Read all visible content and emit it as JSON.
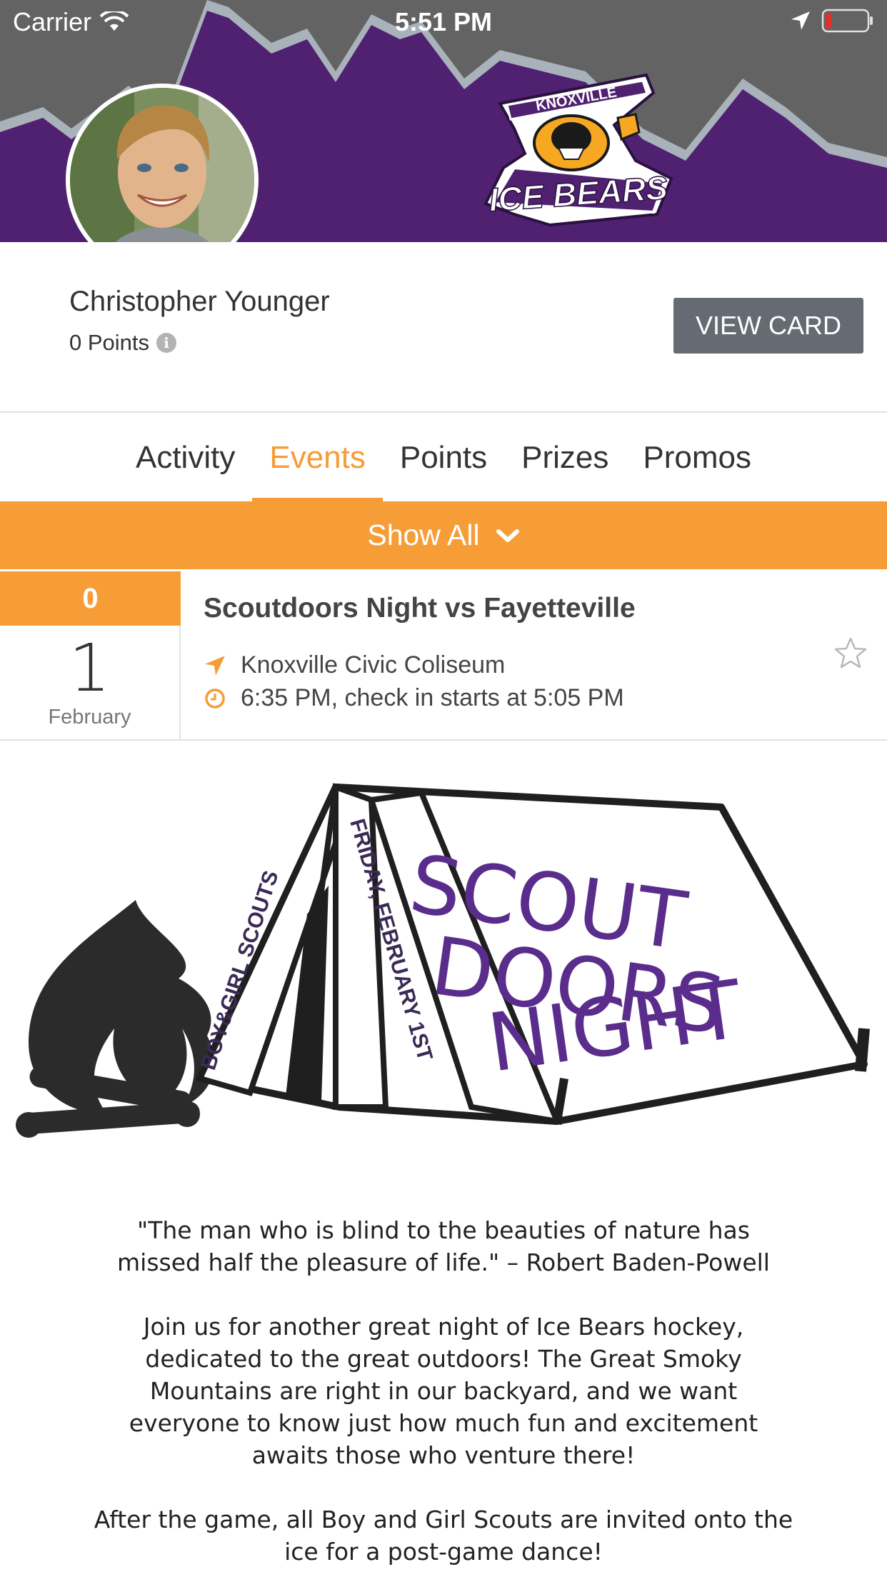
{
  "status_bar": {
    "carrier": "Carrier",
    "time": "5:51 PM"
  },
  "header": {
    "brand_colors": {
      "purple": "#4f2170",
      "orange": "#f79d38",
      "gray": "#646b73"
    },
    "logo_top_text": "KNOXVILLE",
    "logo_main_text": "ICE BEARS"
  },
  "profile": {
    "name": "Christopher Younger",
    "points": "0 Points",
    "view_card_label": "VIEW CARD"
  },
  "tabs": [
    {
      "label": "Activity",
      "active": false
    },
    {
      "label": "Events",
      "active": true
    },
    {
      "label": "Points",
      "active": false
    },
    {
      "label": "Prizes",
      "active": false
    },
    {
      "label": "Promos",
      "active": false
    }
  ],
  "filter": {
    "label": "Show All"
  },
  "event": {
    "points": "0",
    "day": "1",
    "month": "February",
    "title": "Scoutdoors Night vs Fayetteville",
    "location": "Knoxville Civic Coliseum",
    "time": "6:35 PM, check in starts at 5:05 PM"
  },
  "banner": {
    "side_text_1": "BOY&GIRL SCOUTS",
    "side_text_2": "FRIDAY, FEBRUARY 1ST",
    "title_line_1": "SCOUT",
    "title_line_2": "DOORS",
    "title_line_3": "NIGHT"
  },
  "description": {
    "quote_line_1": "\"The man who is blind to the beauties of nature has",
    "quote_line_2": "missed half the pleasure of life.\" – Robert Baden-Powell",
    "para1_line_1": "Join us for another great night of Ice Bears hockey,",
    "para1_line_2": "dedicated to the great outdoors! The Great Smoky",
    "para1_line_3": "Mountains are right in our backyard, and we want",
    "para1_line_4": "everyone to know just how much fun and excitement",
    "para1_line_5": "awaits those who venture there!",
    "para2_line_1": "After the game, all Boy and Girl Scouts are invited onto the",
    "para2_line_2": "ice for a post-game dance!"
  }
}
